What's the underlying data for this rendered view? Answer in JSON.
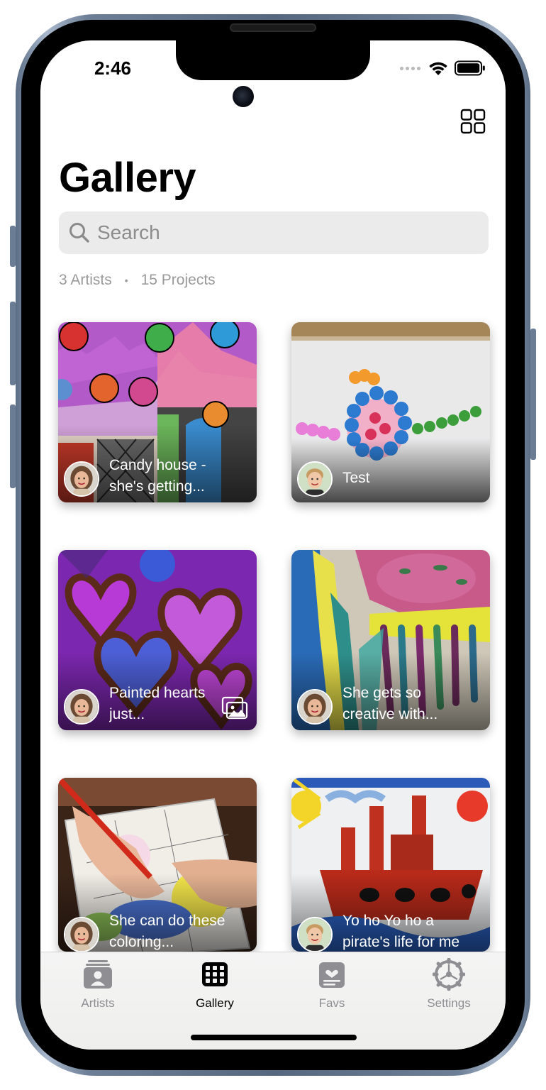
{
  "status_bar": {
    "time": "2:46"
  },
  "header": {
    "title": "Gallery"
  },
  "search": {
    "placeholder": "Search"
  },
  "stats": {
    "artists": "3 Artists",
    "projects": "15 Projects"
  },
  "projects": [
    {
      "caption": "Candy house - she's getting...",
      "artist_avatar": "girl-avatar",
      "multiple_images": false
    },
    {
      "caption": "Test",
      "artist_avatar": "boy-avatar",
      "multiple_images": false
    },
    {
      "caption": "Painted hearts just...",
      "artist_avatar": "girl-avatar",
      "multiple_images": true
    },
    {
      "caption": "She gets so creative with...",
      "artist_avatar": "girl-avatar",
      "multiple_images": false
    },
    {
      "caption": "She can do these coloring...",
      "artist_avatar": "girl-avatar",
      "multiple_images": false
    },
    {
      "caption": "Yo ho Yo ho a pirate's life for me",
      "artist_avatar": "boy-avatar",
      "multiple_images": false
    }
  ],
  "tabs": [
    {
      "label": "Artists",
      "icon": "artists-icon",
      "active": false
    },
    {
      "label": "Gallery",
      "icon": "gallery-grid-icon",
      "active": true
    },
    {
      "label": "Favs",
      "icon": "favs-icon",
      "active": false
    },
    {
      "label": "Settings",
      "icon": "settings-gear-icon",
      "active": false
    }
  ],
  "colors": {
    "active_tab": "#000000",
    "inactive_tab": "#8e8e93",
    "search_bg": "#ebebeb"
  }
}
